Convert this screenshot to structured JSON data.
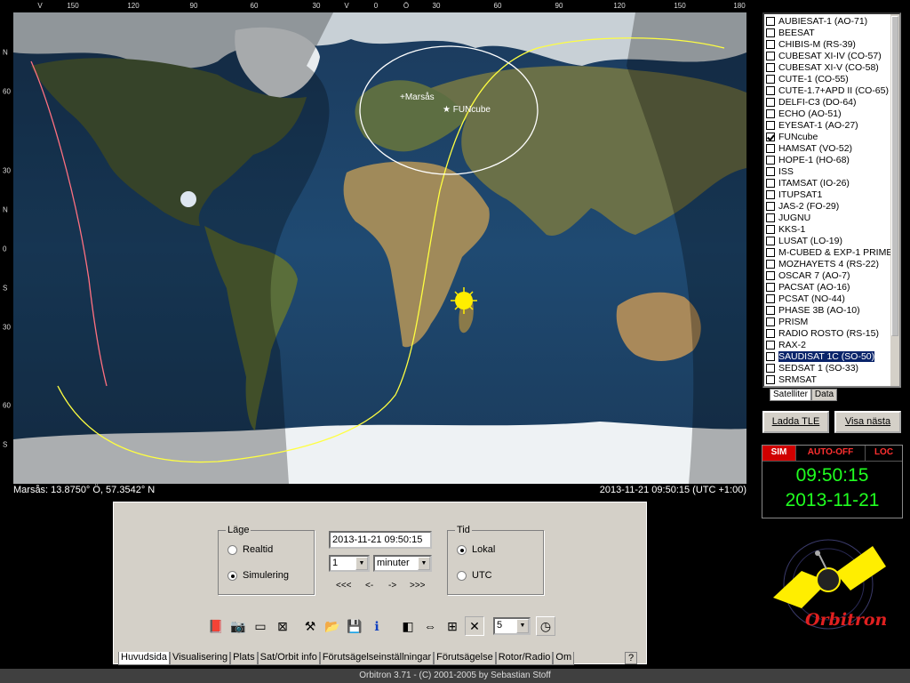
{
  "scale": {
    "top": [
      "V",
      "150",
      "120",
      "90",
      "60",
      "30",
      "V",
      "0",
      "Ö",
      "30",
      "60",
      "90",
      "120",
      "150",
      "180"
    ],
    "left": [
      "N",
      "60",
      "30",
      "N",
      "0",
      "S",
      "30",
      "60",
      "S"
    ]
  },
  "map": {
    "markers": {
      "observer": "Marsås",
      "satellite": "FUNcube"
    }
  },
  "status": {
    "location": "Marsås: 13.8750° Ö, 57.3542° N",
    "datetime": "2013-11-21 09:50:15 (UTC +1:00)"
  },
  "satellites": [
    {
      "name": "AUBIESAT-1 (AO-71)",
      "checked": false
    },
    {
      "name": "BEESAT",
      "checked": false
    },
    {
      "name": "CHIBIS-M (RS-39)",
      "checked": false
    },
    {
      "name": "CUBESAT XI-IV (CO-57)",
      "checked": false
    },
    {
      "name": "CUBESAT XI-V (CO-58)",
      "checked": false
    },
    {
      "name": "CUTE-1 (CO-55)",
      "checked": false
    },
    {
      "name": "CUTE-1.7+APD II (CO-65)",
      "checked": false
    },
    {
      "name": "DELFI-C3 (DO-64)",
      "checked": false
    },
    {
      "name": "ECHO (AO-51)",
      "checked": false
    },
    {
      "name": "EYESAT-1 (AO-27)",
      "checked": false
    },
    {
      "name": "FUNcube",
      "checked": true
    },
    {
      "name": "HAMSAT (VO-52)",
      "checked": false
    },
    {
      "name": "HOPE-1 (HO-68)",
      "checked": false
    },
    {
      "name": "ISS",
      "checked": false
    },
    {
      "name": "ITAMSAT (IO-26)",
      "checked": false
    },
    {
      "name": "ITUPSAT1",
      "checked": false
    },
    {
      "name": "JAS-2 (FO-29)",
      "checked": false
    },
    {
      "name": "JUGNU",
      "checked": false
    },
    {
      "name": "KKS-1",
      "checked": false
    },
    {
      "name": "LUSAT (LO-19)",
      "checked": false
    },
    {
      "name": "M-CUBED & EXP-1 PRIME",
      "checked": false
    },
    {
      "name": "MOZHAYETS 4 (RS-22)",
      "checked": false
    },
    {
      "name": "OSCAR 7 (AO-7)",
      "checked": false
    },
    {
      "name": "PACSAT (AO-16)",
      "checked": false
    },
    {
      "name": "PCSAT (NO-44)",
      "checked": false
    },
    {
      "name": "PHASE 3B (AO-10)",
      "checked": false
    },
    {
      "name": "PRISM",
      "checked": false
    },
    {
      "name": "RADIO ROSTO (RS-15)",
      "checked": false
    },
    {
      "name": "RAX-2",
      "checked": false
    },
    {
      "name": "SAUDISAT 1C (SO-50)",
      "checked": false,
      "selected": true
    },
    {
      "name": "SEDSAT 1 (SO-33)",
      "checked": false
    },
    {
      "name": "SRMSAT",
      "checked": false
    }
  ],
  "sat_tabs": [
    "Satelliter",
    "Data"
  ],
  "buttons": {
    "load_tle": "Ladda TLE",
    "show_next": "Visa nästa"
  },
  "clock": {
    "flags": [
      {
        "label": "SIM",
        "bg": "#d00000",
        "color": "#ffffff"
      },
      {
        "label": "AUTO-OFF",
        "bg": "#000000",
        "color": "#ff3030"
      },
      {
        "label": "LOC",
        "bg": "#000000",
        "color": "#ff3030"
      }
    ],
    "time": "09:50:15",
    "date": "2013-11-21"
  },
  "logo": {
    "text": "Orbitron"
  },
  "panel": {
    "mode": {
      "legend": "Läge",
      "realtime": "Realtid",
      "simulation": "Simulering",
      "selected": "simulation"
    },
    "datetime_value": "2013-11-21 09:50:15",
    "step_value": "1",
    "step_unit": "minuter",
    "step_buttons": [
      "<<<",
      "<-",
      "->",
      ">>>"
    ],
    "time": {
      "legend": "Tid",
      "local": "Lokal",
      "utc": "UTC",
      "selected": "local"
    },
    "zoom_value": "5"
  },
  "main_tabs": [
    "Huvudsida",
    "Visualisering",
    "Plats",
    "Sat/Orbit info",
    "Förutsägelseinställningar",
    "Förutsägelse",
    "Rotor/Radio",
    "Om"
  ],
  "help_tab": "?",
  "footer": "Orbitron 3.71 - (C) 2001-2005 by Sebastian Stoff"
}
